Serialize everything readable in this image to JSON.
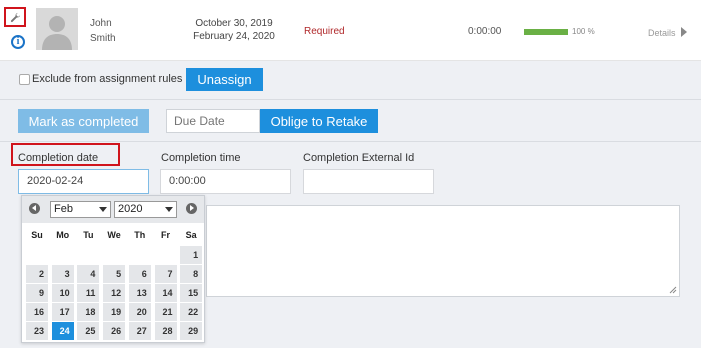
{
  "user": {
    "first_name": "John",
    "last_name": "Smith",
    "date_1": "October 30, 2019",
    "date_2": "February 24, 2020",
    "status": "Required",
    "duration": "0:00:00",
    "progress_percent": 100,
    "progress_label": "100 %",
    "details_label": "Details"
  },
  "assignment": {
    "exclude_label": "Exclude from assignment rules",
    "exclude_checked": false,
    "unassign_label": "Unassign"
  },
  "actions": {
    "mark_completed_label": "Mark as completed",
    "due_date_placeholder": "Due Date",
    "oblige_label": "Oblige to Retake"
  },
  "fields": {
    "completion_date_label": "Completion date",
    "completion_date_value": "2020-02-24",
    "completion_time_label": "Completion time",
    "completion_time_value": "0:00:00",
    "completion_ext_label": "Completion External Id",
    "completion_ext_value": ""
  },
  "datepicker": {
    "month": "Feb",
    "year": "2020",
    "weekdays": [
      "Su",
      "Mo",
      "Tu",
      "We",
      "Th",
      "Fr",
      "Sa"
    ],
    "weeks": [
      [
        "",
        "",
        "",
        "",
        "",
        "",
        "1"
      ],
      [
        "2",
        "3",
        "4",
        "5",
        "6",
        "7",
        "8"
      ],
      [
        "9",
        "10",
        "11",
        "12",
        "13",
        "14",
        "15"
      ],
      [
        "16",
        "17",
        "18",
        "19",
        "20",
        "21",
        "22"
      ],
      [
        "23",
        "24",
        "25",
        "26",
        "27",
        "28",
        "29"
      ]
    ],
    "selected_day": "24"
  },
  "icons": {
    "settings": "wrench-icon",
    "info": "info-icon",
    "avatar": "user-silhouette",
    "details": "chevron-right-icon",
    "prev": "prev-month-icon",
    "next": "next-month-icon"
  },
  "colors": {
    "accent": "#1d8fdd",
    "status_required": "#b0282a",
    "progress": "#6ab045",
    "highlight": "#d0141c"
  }
}
